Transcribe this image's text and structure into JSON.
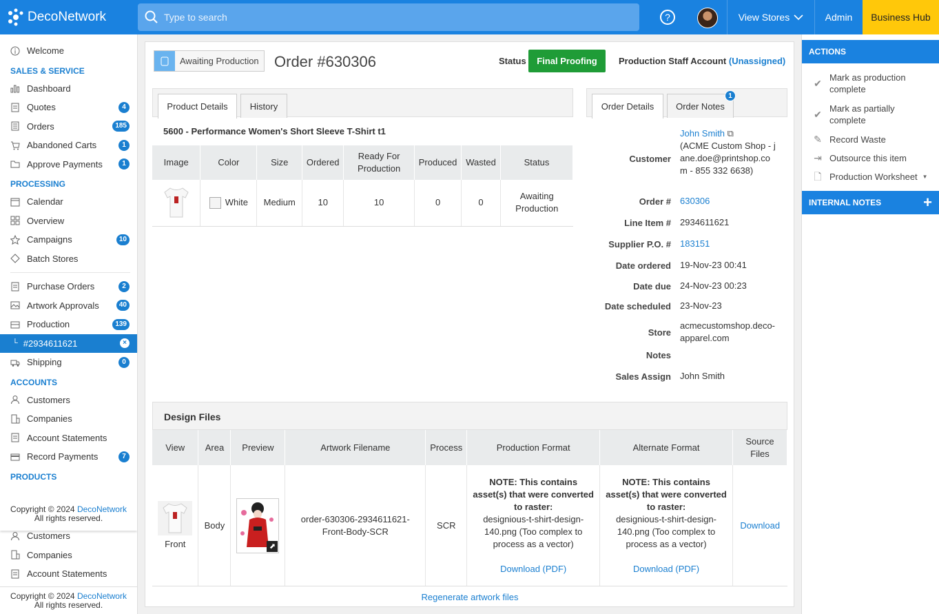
{
  "topbar": {
    "brand": "DecoNetwork",
    "search_placeholder": "Type to search",
    "help": "?",
    "view_stores": "View Stores",
    "admin": "Admin",
    "business_hub": "Business Hub"
  },
  "sidebar": {
    "welcome": "Welcome",
    "sales_header": "SALES & SERVICE",
    "dashboard": "Dashboard",
    "quotes": "Quotes",
    "quotes_count": "4",
    "orders": "Orders",
    "orders_count": "185",
    "abandoned": "Abandoned Carts",
    "abandoned_count": "1",
    "approve": "Approve Payments",
    "approve_count": "1",
    "processing_header": "PROCESSING",
    "calendar": "Calendar",
    "overview": "Overview",
    "campaigns": "Campaigns",
    "campaigns_count": "10",
    "batch": "Batch Stores",
    "purchase": "Purchase Orders",
    "purchase_count": "2",
    "artwork": "Artwork Approvals",
    "artwork_count": "40",
    "production": "Production",
    "production_count": "139",
    "active_item": "#2934611621",
    "shipping": "Shipping",
    "shipping_count": "0",
    "accounts_header": "ACCOUNTS",
    "customers": "Customers",
    "companies": "Companies",
    "statements": "Account Statements",
    "record_payments": "Record Payments",
    "record_payments_count": "7",
    "products_header": "PRODUCTS",
    "copyright": "Copyright © 2024 ",
    "copyright_link": "DecoNetwork",
    "rights": "All rights reserved."
  },
  "header": {
    "tag": "Awaiting Production",
    "order_title": "Order #630306",
    "status_label": "Status",
    "status_value": "Final Proofing",
    "staff_label": "Production Staff Account",
    "staff_value": "(Unassigned)"
  },
  "left_tabs": [
    "Product Details",
    "History"
  ],
  "right_tabs": [
    "Order Details",
    "Order Notes"
  ],
  "order_notes_count": "1",
  "product": {
    "name": "5600 - Performance Women's Short Sleeve T-Shirt t1",
    "columns": [
      "Image",
      "Color",
      "Size",
      "Ordered",
      "Ready For Production",
      "Produced",
      "Wasted",
      "Status"
    ],
    "row": {
      "color": "White",
      "size": "Medium",
      "ordered": "10",
      "ready": "10",
      "produced": "0",
      "wasted": "0",
      "status": "Awaiting Production"
    }
  },
  "order_details": {
    "customer_label": "Customer",
    "customer_name": "John Smith",
    "customer_info": "(ACME Custom Shop - jane.doe@printshop.com - 855 332 6638)",
    "order_label": "Order #",
    "order_value": "630306",
    "line_label": "Line Item #",
    "line_value": "2934611621",
    "supplier_label": "Supplier P.O. #",
    "supplier_value": "183151",
    "ordered_label": "Date ordered",
    "ordered_value": "19-Nov-23 00:41",
    "due_label": "Date due",
    "due_value": "24-Nov-23 00:23",
    "scheduled_label": "Date scheduled",
    "scheduled_value": "23-Nov-23",
    "store_label": "Store",
    "store_value": "acmecustomshop.deco-apparel.com",
    "notes_label": "Notes",
    "notes_value": "",
    "sales_label": "Sales Assign",
    "sales_value": "John Smith"
  },
  "design": {
    "title": "Design Files",
    "columns": [
      "View",
      "Area",
      "Preview",
      "Artwork Filename",
      "Process",
      "Production Format",
      "Alternate Format",
      "Source Files"
    ],
    "row": {
      "view": "Front",
      "area": "Body",
      "filename": "order-630306-2934611621-Front-Body-SCR",
      "process": "SCR",
      "note": "NOTE: This contains asset(s) that were converted to raster:",
      "note_detail": "designious-t-shirt-design-140.png (Too complex to process as a vector)",
      "download_pdf": "Download (PDF)",
      "source": "Download"
    },
    "regenerate": "Regenerate artwork files"
  },
  "actions": {
    "title": "ACTIONS",
    "items": [
      "Mark as production complete",
      "Mark as partially complete",
      "Record Waste",
      "Outsource this item",
      "Production Worksheet"
    ],
    "internal_notes": "INTERNAL NOTES"
  }
}
